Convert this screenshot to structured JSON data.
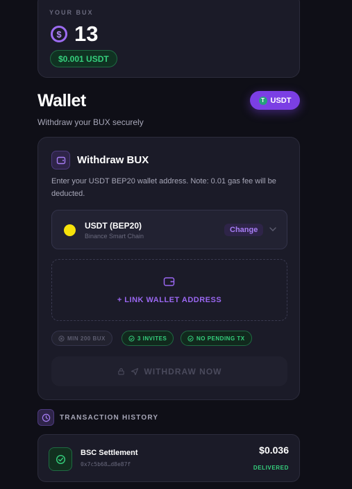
{
  "bux": {
    "label": "YOUR BUX",
    "coin_symbol": "$",
    "amount": "13",
    "usdt_value": "$0.001 USDT"
  },
  "wallet": {
    "title": "Wallet",
    "subtitle": "Withdraw your BUX securely",
    "currency_button": "USDT",
    "currency_icon_glyph": "T"
  },
  "withdraw": {
    "title": "Withdraw BUX",
    "description": "Enter your USDT BEP20 wallet address. Note: 0.01 gas fee will be deducted.",
    "token": {
      "name": "USDT (BEP20)",
      "chain": "Binance Smart Chain",
      "change_label": "Change",
      "dot_color": "#f6e20a"
    },
    "link_wallet_label": "+ LINK WALLET ADDRESS",
    "requirements": [
      {
        "label": "MIN 200 BUX",
        "met": false
      },
      {
        "label": "3 INVITES",
        "met": true
      },
      {
        "label": "NO PENDING TX",
        "met": true
      }
    ],
    "withdraw_button": "WITHDRAW NOW"
  },
  "history": {
    "title": "TRANSACTION HISTORY",
    "transactions": [
      {
        "name": "BSC Settlement",
        "hash": "0x7c5b68…d8e87f",
        "amount": "$0.036",
        "status": "DELIVERED"
      }
    ]
  },
  "colors": {
    "accent": "#7b3fe4",
    "success": "#35d07d",
    "background": "#0f0f17",
    "card": "#1b1b28"
  },
  "icons": [
    "dollar-coin-icon",
    "tether-icon",
    "wallet-icon",
    "chevron-down-icon",
    "x-circle-icon",
    "check-circle-icon",
    "lock-icon",
    "send-icon",
    "clock-icon"
  ]
}
